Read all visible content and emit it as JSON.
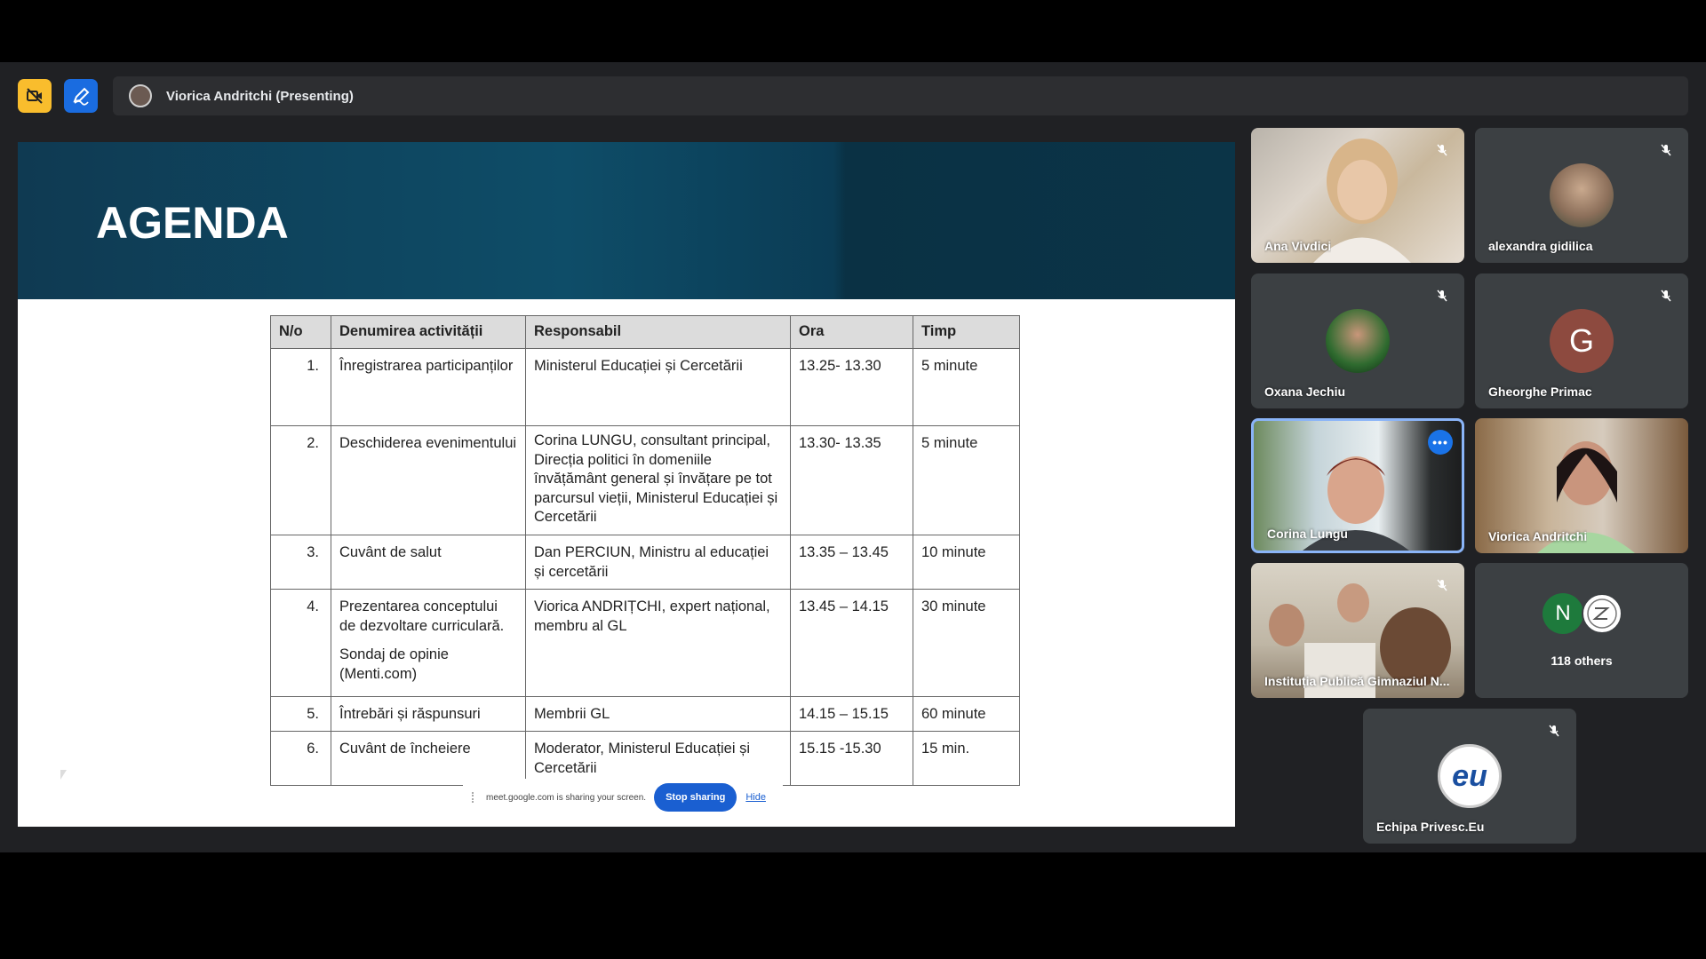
{
  "topbar": {
    "camera_off_icon": "camera-off-icon",
    "annotate_icon": "annotate-pen-icon",
    "presenter_label": "Viorica Andritchi (Presenting)"
  },
  "slide": {
    "title": "AGENDA",
    "table": {
      "headers": [
        "N/o",
        "Denumirea activității",
        "Responsabil",
        "Ora",
        "Timp"
      ],
      "rows": [
        {
          "num": "1.",
          "activity": "Înregistrarea participanților",
          "activity_sub": "",
          "responsible": "Ministerul Educației și Cercetării",
          "time": "13.25- 13.30",
          "duration": "5 minute"
        },
        {
          "num": "2.",
          "activity": "Deschiderea evenimentului",
          "activity_sub": "",
          "responsible": "Corina LUNGU, consultant principal, Direcția politici în domeniile învățământ general și învățare pe tot parcursul vieții, Ministerul Educației și Cercetării",
          "time": "13.30- 13.35",
          "duration": "5 minute"
        },
        {
          "num": "3.",
          "activity": "Cuvânt de salut",
          "activity_sub": "",
          "responsible": "Dan PERCIUN, Ministru al educației și cercetării",
          "time": "13.35 – 13.45",
          "duration": "10 minute"
        },
        {
          "num": "4.",
          "activity": "Prezentarea conceptului de dezvoltare curriculară.",
          "activity_sub": "Sondaj de opinie (Menti.com)",
          "responsible": "Viorica ANDRIȚCHI, expert național, membru al GL",
          "time": "13.45 – 14.15",
          "duration": "30 minute"
        },
        {
          "num": "5.",
          "activity": "Întrebări și răspunsuri",
          "activity_sub": "",
          "responsible": "Membrii GL",
          "time": "14.15 – 15.15",
          "duration": "60 minute"
        },
        {
          "num": "6.",
          "activity": "Cuvânt de încheiere",
          "activity_sub": "",
          "responsible": "Moderator, Ministerul Educației și Cercetării",
          "time": "15.15 -15.30",
          "duration": "15 min."
        }
      ]
    },
    "share_bar": {
      "message": "meet.google.com is sharing your screen.",
      "stop_label": "Stop sharing",
      "hide_label": "Hide"
    }
  },
  "participants": [
    {
      "name": "Ana Vivdici",
      "muted": true,
      "kind": "video"
    },
    {
      "name": "alexandra gidilica",
      "muted": true,
      "kind": "photo"
    },
    {
      "name": "Oxana Jechiu",
      "muted": true,
      "kind": "photo"
    },
    {
      "name": "Gheorghe Primac",
      "muted": true,
      "kind": "letter",
      "letter": "G"
    },
    {
      "name": "Corina Lungu",
      "muted": false,
      "kind": "video",
      "active": true
    },
    {
      "name": "Viorica Andritchi",
      "muted": false,
      "kind": "video"
    },
    {
      "name": "Instituția Publică Gimnaziul N...",
      "muted": true,
      "kind": "video"
    },
    {
      "name": "118 others",
      "muted": false,
      "kind": "others",
      "letter": "N"
    },
    {
      "name": "Echipa Privesc.Eu",
      "muted": true,
      "kind": "logo",
      "logo_text": "eu"
    }
  ],
  "colors": {
    "accent_blue": "#1a73e8",
    "stage_bg": "#202124",
    "tile_bg": "#3c4043",
    "banner_teal": "#0e4d68",
    "camera_btn": "#f9bd2d",
    "annotate_btn": "#1a6ce0"
  }
}
